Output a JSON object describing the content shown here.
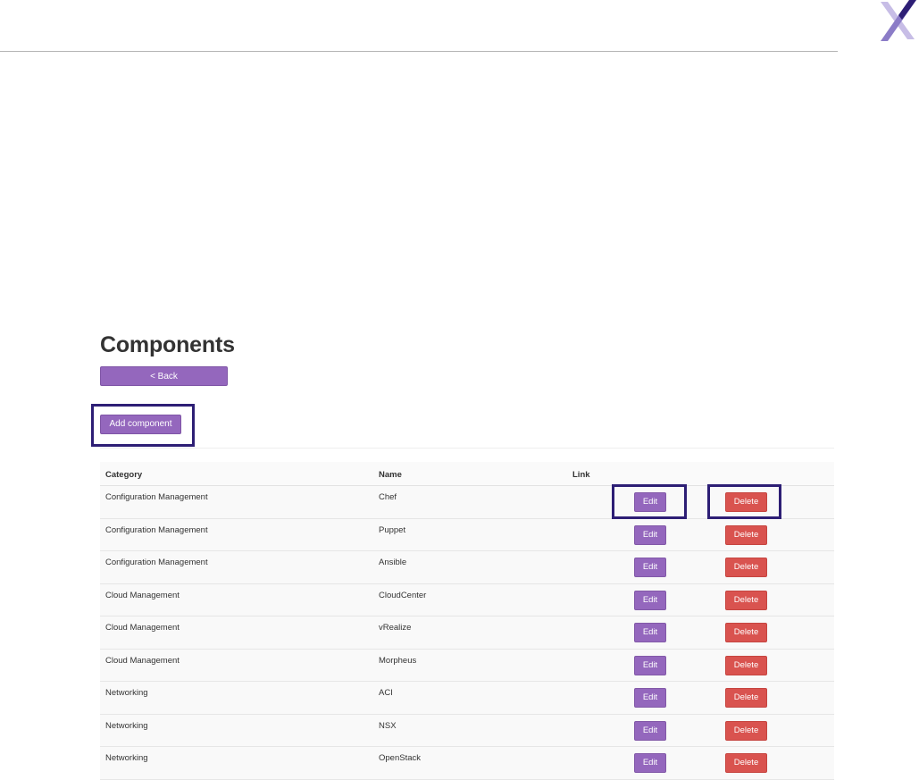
{
  "page": {
    "title": "Components",
    "back_label": "< Back",
    "add_label": "Add component"
  },
  "table": {
    "headers": {
      "category": "Category",
      "name": "Name",
      "link": "Link"
    },
    "rows": [
      {
        "category": "Configuration Management",
        "name": "Chef",
        "edit": "Edit",
        "delete": "Delete"
      },
      {
        "category": "Configuration Management",
        "name": "Puppet",
        "edit": "Edit",
        "delete": "Delete"
      },
      {
        "category": "Configuration Management",
        "name": "Ansible",
        "edit": "Edit",
        "delete": "Delete"
      },
      {
        "category": "Cloud Management",
        "name": "CloudCenter",
        "edit": "Edit",
        "delete": "Delete"
      },
      {
        "category": "Cloud Management",
        "name": "vRealize",
        "edit": "Edit",
        "delete": "Delete"
      },
      {
        "category": "Cloud Management",
        "name": "Morpheus",
        "edit": "Edit",
        "delete": "Delete"
      },
      {
        "category": "Networking",
        "name": "ACI",
        "edit": "Edit",
        "delete": "Delete"
      },
      {
        "category": "Networking",
        "name": "NSX",
        "edit": "Edit",
        "delete": "Delete"
      },
      {
        "category": "Networking",
        "name": "OpenStack",
        "edit": "Edit",
        "delete": "Delete"
      }
    ]
  },
  "colors": {
    "primary": "#9467bd",
    "danger": "#d9534f",
    "highlight": "#2d1e75"
  },
  "icons": {
    "logo": "x-logo-icon"
  }
}
